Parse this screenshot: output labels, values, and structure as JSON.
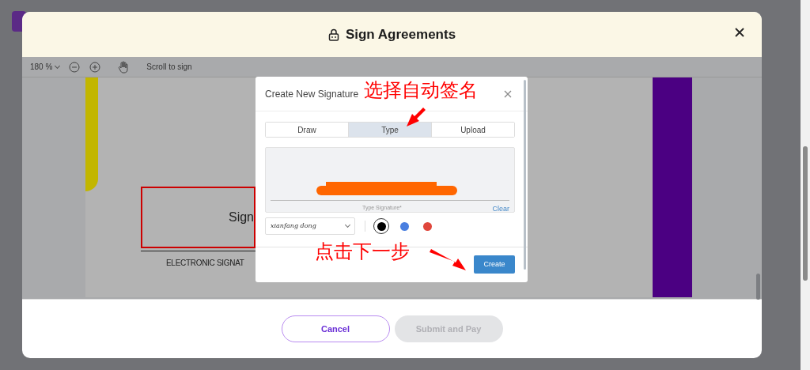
{
  "modal": {
    "title": "Sign Agreements"
  },
  "toolbar": {
    "zoom": "180 %",
    "hint": "Scroll to sign"
  },
  "document": {
    "sign_field": "Sign",
    "caption": "ELECTRONIC SIGNAT"
  },
  "dialog": {
    "title": "Create New Signature",
    "tabs": [
      {
        "label": "Draw",
        "selected": false
      },
      {
        "label": "Type",
        "selected": true
      },
      {
        "label": "Upload",
        "selected": false
      }
    ],
    "pad_label": "Type Signature*",
    "clear": "Clear",
    "font": "xianfang dong",
    "colors": [
      {
        "color": "#000000",
        "selected": true
      },
      {
        "color": "#4a7fe0",
        "selected": false
      },
      {
        "color": "#e0473c",
        "selected": false
      }
    ],
    "create": "Create"
  },
  "annotations": [
    {
      "text": "选择自动签名"
    },
    {
      "text": "点击下一步"
    }
  ],
  "footer": {
    "buttons": [
      {
        "label": "Cancel",
        "disabled": false
      },
      {
        "label": "Submit and Pay",
        "disabled": true
      }
    ]
  }
}
